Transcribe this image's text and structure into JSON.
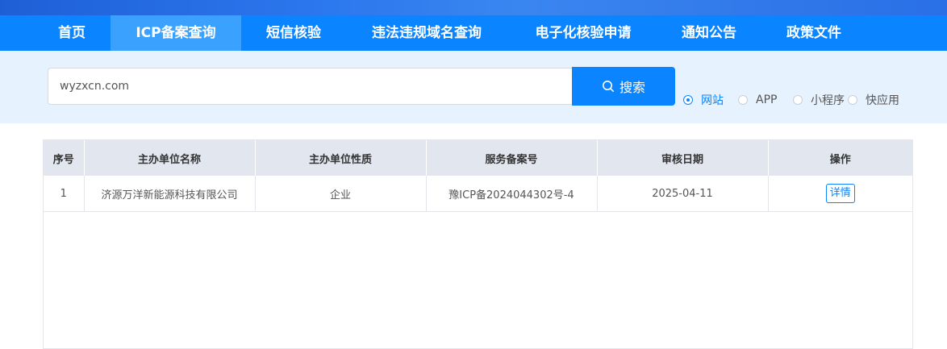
{
  "nav": {
    "items": [
      {
        "label": "首页"
      },
      {
        "label": "ICP备案查询"
      },
      {
        "label": "短信核验"
      },
      {
        "label": "违法违规域名查询"
      },
      {
        "label": "电子化核验申请"
      },
      {
        "label": "通知公告"
      },
      {
        "label": "政策文件"
      }
    ],
    "active": "ICP备案查询"
  },
  "search": {
    "value": "wyzxcn.com",
    "button_label": "搜索",
    "options": [
      {
        "label": "网站",
        "checked": true
      },
      {
        "label": "APP",
        "checked": false
      },
      {
        "label": "小程序",
        "checked": false
      },
      {
        "label": "快应用",
        "checked": false
      }
    ]
  },
  "table": {
    "headers": [
      "序号",
      "主办单位名称",
      "主办单位性质",
      "服务备案号",
      "审核日期",
      "操作"
    ],
    "rows": [
      {
        "index": "1",
        "unit_name": "济源万洋新能源科技有限公司",
        "unit_nature": "企业",
        "record_no": "豫ICP备2024044302号-4",
        "review_date": "2025-04-11",
        "action": "详情"
      }
    ]
  },
  "colors": {
    "primary": "#0a84ff",
    "nav_active": "#3aa1ff",
    "search_band": "#e6f2fd",
    "table_header": "#e1e6ef"
  }
}
